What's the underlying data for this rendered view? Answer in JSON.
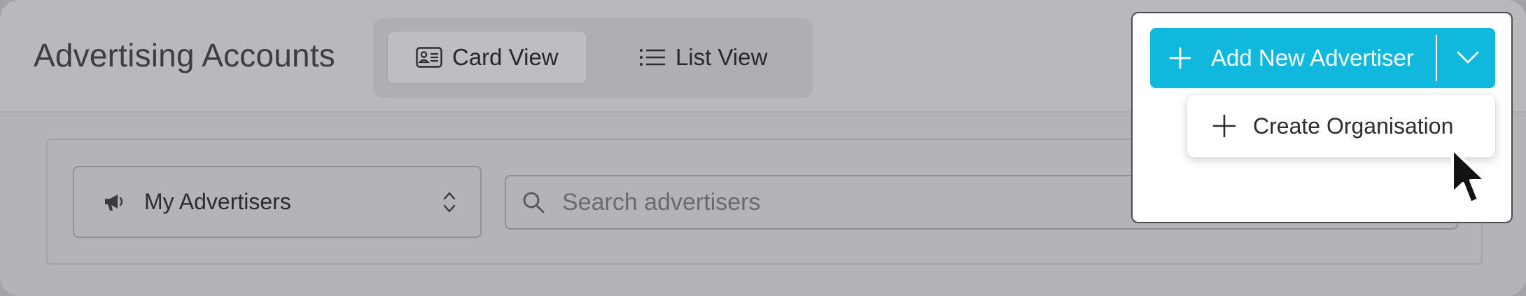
{
  "header": {
    "title": "Advertising Accounts"
  },
  "view_switch": {
    "card_label": "Card View",
    "list_label": "List View",
    "selected": "card"
  },
  "filters": {
    "advertiser_select_value": "My Advertisers",
    "search_placeholder": "Search advertisers"
  },
  "actions": {
    "add_new_label": "Add New Advertiser",
    "menu_items": [
      {
        "label": "Create Organisation",
        "icon": "plus-icon"
      }
    ]
  },
  "colors": {
    "primary": "#0fb8dc",
    "overlay": "#b3b4b7"
  }
}
